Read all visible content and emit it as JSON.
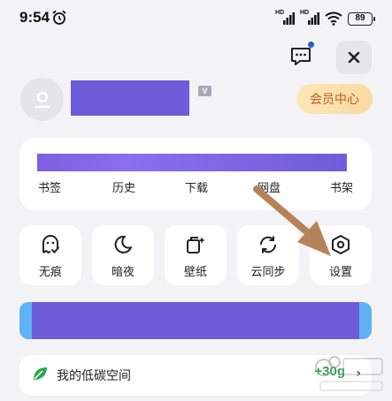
{
  "status_bar": {
    "time": "9:54",
    "battery": "89",
    "signal_label": "HD"
  },
  "header": {
    "vip_label": "会员中心",
    "level_badge": "V"
  },
  "quick_access": {
    "items": [
      {
        "label": "书签"
      },
      {
        "label": "历史"
      },
      {
        "label": "下载"
      },
      {
        "label": "网盘"
      },
      {
        "label": "书架"
      }
    ]
  },
  "tools": [
    {
      "label": "无痕",
      "icon": "ghost-icon"
    },
    {
      "label": "暗夜",
      "icon": "moon-icon"
    },
    {
      "label": "壁纸",
      "icon": "wallpaper-icon"
    },
    {
      "label": "云同步",
      "icon": "sync-icon"
    },
    {
      "label": "设置",
      "icon": "settings-icon"
    }
  ],
  "eco": {
    "label": "我的低碳空间",
    "value": "+30g",
    "icon": "leaf-icon"
  },
  "colors": {
    "redaction": "#6f5cd8",
    "annotation_arrow": "#b5835a",
    "vip_text": "#b6621a",
    "eco_green": "#2ea44f"
  }
}
